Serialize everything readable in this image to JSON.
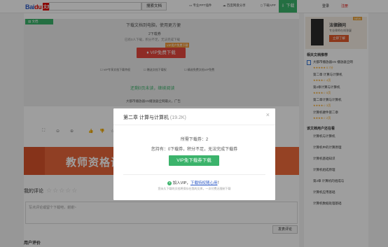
{
  "header": {
    "logo_bai": "Bai",
    "logo_du": "du",
    "logo_wenku": "文库",
    "search_placeholder": "",
    "search_button": "搜索文档",
    "link_pc": "专业PPT插件",
    "link_share": "百度网盘分享",
    "link_download_app": "下载APP",
    "download_button": "下载",
    "login": "登录",
    "register": "注册"
  },
  "preview": {
    "tag": "文档",
    "line1": "下载文档到电脑，使用更方便",
    "coupon": "2下载券",
    "sub": "已有0人下载，积分不足，无法完成下载",
    "vip_button": "VIP免费下载",
    "vip_badge": "VIP用户免费下载",
    "opt1": "VIP专享文档下载特权",
    "opt2": "赠送文档下载权",
    "opt3": "精选免费文档VIP免费",
    "next_page": "还剩0页未读，继续阅读",
    "promo": "大都市播放器VS播放器全网最火，广告"
  },
  "toolbar": {
    "items": [
      "⛶",
      "⊖",
      "⊕",
      "👍",
      "👎",
      "☆",
      "⇩"
    ]
  },
  "banner": {
    "text": "教师资格证《报",
    "tag": "广告"
  },
  "comments": {
    "rating_label": "我的评论",
    "stars": "☆☆☆☆☆",
    "placeholder": "写点评论或留个下载吧，谢谢~",
    "submit": "发表评论",
    "user_reviews": "用户评价"
  },
  "right": {
    "ad": {
      "new": "NEW",
      "title": "法律顾问",
      "subtitle": "专业律师在线答疑",
      "button": "立即了解"
    },
    "related_head": "相关文档推荐",
    "related": [
      "大都市播放器VS 播放器全网",
      "第二章 计算与计算机",
      "第2章计算与计算机",
      "第二章计算与计算机",
      "计算机硬件第二章",
      "第二章 计算机基础知识",
      "计算机导论第二章"
    ],
    "related_stars": [
      "★★★★★ 0.7分",
      "★★★★☆ 4页",
      "★★★★☆ 5页",
      "★★★★☆ 3页",
      "★★★★☆ 2页",
      "★★★★☆ 6页",
      "★★★★☆ 4页"
    ],
    "hot_head": "该文档用户还在看",
    "hot": [
      "计算机与计算机",
      "计算机中的计算原理",
      "计算机基础知识",
      "计算机组成原理",
      "第2章 计算机的组成与",
      "计算机应用基础",
      "计算机数据处理基础"
    ]
  },
  "modal": {
    "title": "第二章 计算与计算机",
    "size": "(19.2K)",
    "count_label": "所需下载券：",
    "count_value": "2",
    "have_text": "您持有：0下载券，积分不足，无法完成下载券",
    "button": "VIP免下载券下载",
    "vip_prefix": "加入VIP，",
    "vip_link": "下载特权随心用",
    "vip_suffix": "！",
    "note": "您永久下载的文档将保存在我的文库，一次付费无限制下载"
  }
}
